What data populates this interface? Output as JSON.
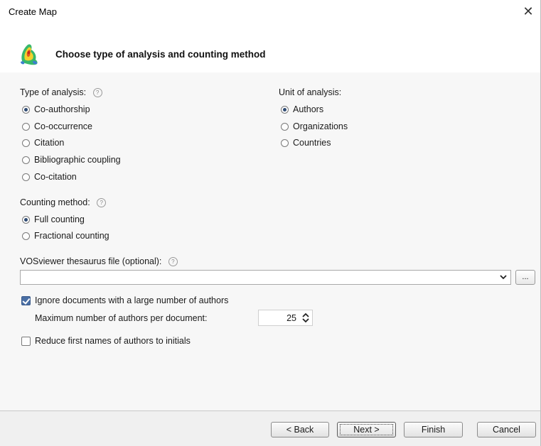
{
  "window": {
    "title": "Create Map"
  },
  "header": {
    "title": "Choose type of analysis and counting method"
  },
  "type_of_analysis": {
    "label": "Type of analysis:",
    "options": [
      {
        "label": "Co-authorship",
        "checked": true
      },
      {
        "label": "Co-occurrence",
        "checked": false
      },
      {
        "label": "Citation",
        "checked": false
      },
      {
        "label": "Bibliographic coupling",
        "checked": false
      },
      {
        "label": "Co-citation",
        "checked": false
      }
    ]
  },
  "unit_of_analysis": {
    "label": "Unit of analysis:",
    "options": [
      {
        "label": "Authors",
        "checked": true
      },
      {
        "label": "Organizations",
        "checked": false
      },
      {
        "label": "Countries",
        "checked": false
      }
    ]
  },
  "counting_method": {
    "label": "Counting method:",
    "options": [
      {
        "label": "Full counting",
        "checked": true
      },
      {
        "label": "Fractional counting",
        "checked": false
      }
    ]
  },
  "thesaurus": {
    "label": "VOSviewer thesaurus file (optional):",
    "value": "",
    "browse_label": "..."
  },
  "ignore_large": {
    "label": "Ignore documents with a large number of authors",
    "checked": true
  },
  "max_authors": {
    "label": "Maximum number of authors per document:",
    "value": "25"
  },
  "reduce_names": {
    "label": "Reduce first names of authors to initials",
    "checked": false
  },
  "footer": {
    "back_label": "< Back",
    "next_label": "Next >",
    "finish_label": "Finish",
    "cancel_label": "Cancel"
  },
  "icons": {
    "close": "close-icon",
    "help": "help-icon",
    "logo": "vosviewer-logo-icon",
    "dropdown": "chevron-down-icon",
    "spinner": "spinner-arrows-icon"
  },
  "colors": {
    "radio_selected": "#2f4b73",
    "checkbox_checked": "#4a6fa5",
    "content_bg": "#f7f7f7"
  }
}
